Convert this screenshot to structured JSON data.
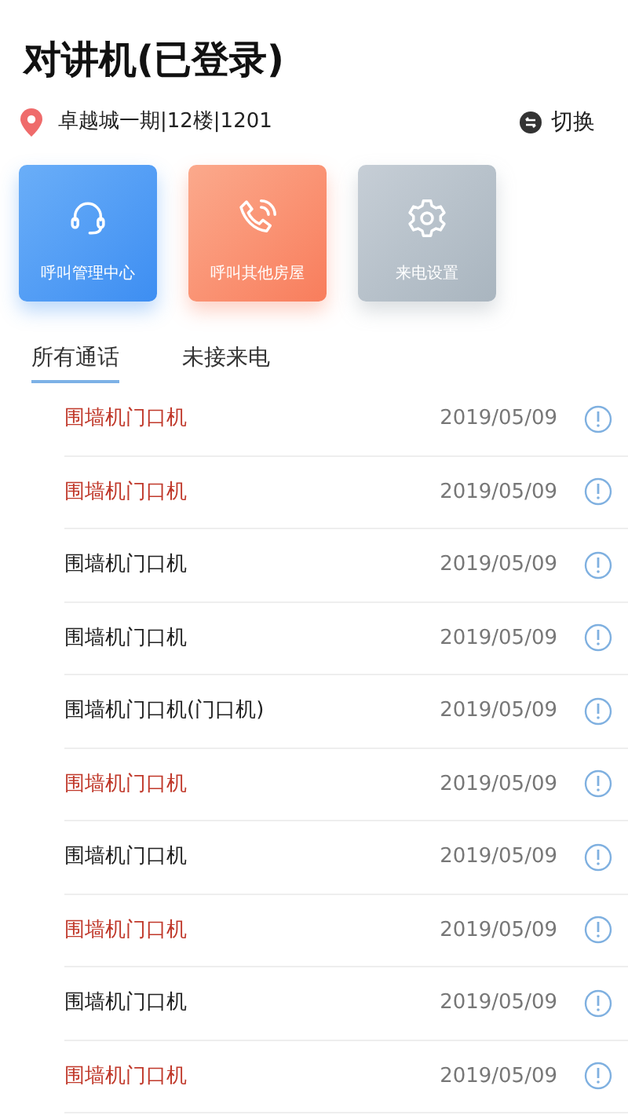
{
  "title": "对讲机(已登录)",
  "location": {
    "address": "卓越城一期|12楼|1201",
    "switch_label": "切换"
  },
  "actions": [
    {
      "kind": "headset",
      "label": "呼叫管理中心"
    },
    {
      "kind": "phone",
      "label": "呼叫其他房屋"
    },
    {
      "kind": "gear",
      "label": "来电设置"
    }
  ],
  "tabs": [
    {
      "label": "所有通话",
      "selected": true
    },
    {
      "label": "未接来电",
      "selected": false
    }
  ],
  "calls": [
    {
      "name": "围墙机门口机",
      "date": "2019/05/09",
      "missed": true
    },
    {
      "name": "围墙机门口机",
      "date": "2019/05/09",
      "missed": true
    },
    {
      "name": "围墙机门口机",
      "date": "2019/05/09",
      "missed": false
    },
    {
      "name": "围墙机门口机",
      "date": "2019/05/09",
      "missed": false
    },
    {
      "name": "围墙机门口机(门口机)",
      "date": "2019/05/09",
      "missed": false
    },
    {
      "name": "围墙机门口机",
      "date": "2019/05/09",
      "missed": true
    },
    {
      "name": "围墙机门口机",
      "date": "2019/05/09",
      "missed": false
    },
    {
      "name": "围墙机门口机",
      "date": "2019/05/09",
      "missed": true
    },
    {
      "name": "围墙机门口机",
      "date": "2019/05/09",
      "missed": false
    },
    {
      "name": "围墙机门口机",
      "date": "2019/05/09",
      "missed": true
    }
  ]
}
